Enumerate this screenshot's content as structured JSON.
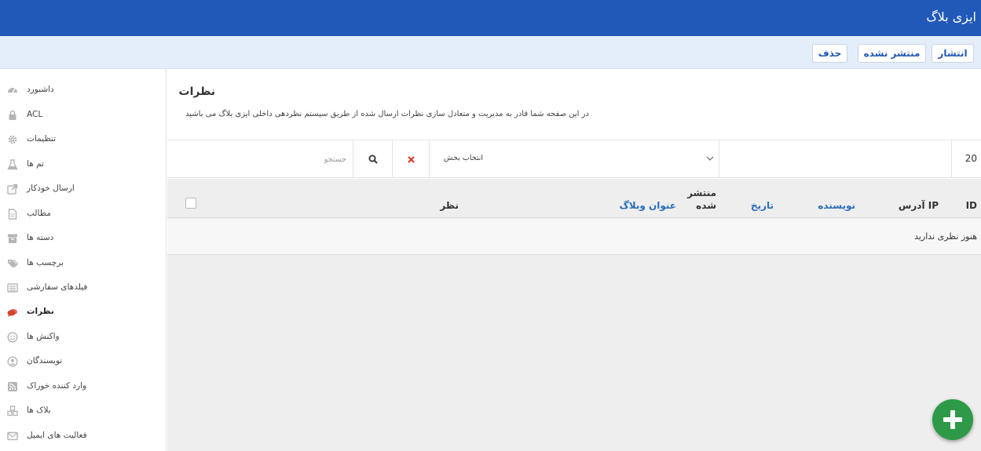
{
  "header": {
    "brand": "ایزی بلاگ"
  },
  "actions": {
    "publish": "انتشار",
    "unpublish": "منتشر نشده",
    "delete": "حذف"
  },
  "sidebar": {
    "items": [
      {
        "label": "داشبورد",
        "icon": "dashboard-icon"
      },
      {
        "label": "ACL",
        "icon": "lock-icon"
      },
      {
        "label": "تنظیمات",
        "icon": "gear-icon"
      },
      {
        "label": "تم ها",
        "icon": "flask-icon"
      },
      {
        "label": "ارسال خودکار",
        "icon": "share-icon"
      },
      {
        "label": "مطالب",
        "icon": "document-icon"
      },
      {
        "label": "دسته ها",
        "icon": "archive-icon"
      },
      {
        "label": "برچسب ها",
        "icon": "tags-icon"
      },
      {
        "label": "فیلدهای سفارشی",
        "icon": "list-icon"
      },
      {
        "label": "نظرات",
        "icon": "comments-icon",
        "active": true
      },
      {
        "label": "واکنش ها",
        "icon": "smile-icon"
      },
      {
        "label": "نویسندگان",
        "icon": "user-circle-icon"
      },
      {
        "label": "وارد کننده خوراک",
        "icon": "rss-icon"
      },
      {
        "label": "بلاک ها",
        "icon": "cubes-icon"
      },
      {
        "label": "فعالیت های ایمیل",
        "icon": "envelope-icon"
      }
    ]
  },
  "page": {
    "title": "نظرات",
    "description": "در این صفحه شما قادر به مدیریت و متعادل سازی نظرات ارسال شده از طریق سیستم نظردهی داخلی ایزی بلاگ می باشید"
  },
  "filters": {
    "search_placeholder": "جستجو",
    "section_select": "انتخاب بخش",
    "per_page": "20"
  },
  "table": {
    "columns": {
      "id": "ID",
      "ip": "IP آدرس",
      "author": "نویسنده",
      "date": "تاریخ",
      "published_line1": "منتشر",
      "published_line2": "شده",
      "blog_title": "عنوان وبلاگ",
      "comment": "نظر"
    },
    "empty_message": "هنوز نظری ندارید"
  },
  "colors": {
    "header": "#2159b8",
    "accent": "#2a6ebb",
    "fab": "#2e9a47",
    "active_icon": "#d9412f"
  }
}
